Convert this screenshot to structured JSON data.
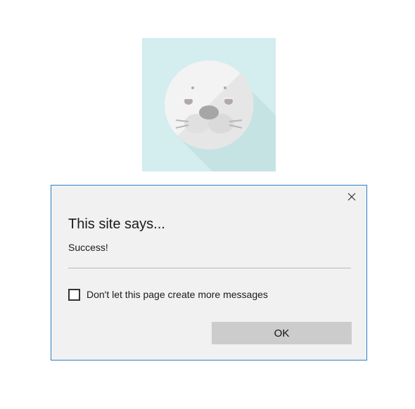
{
  "dialog": {
    "title": "This site says...",
    "message": "Success!",
    "checkbox_label": "Don't let this page create more messages",
    "checkbox_checked": false,
    "ok_label": "OK"
  },
  "colors": {
    "tile_background": "#d4edef",
    "dialog_background": "#f1f1f1",
    "dialog_border": "#2b7fc7",
    "ok_button": "#cccccc"
  },
  "icons": {
    "site_image": "seal-face-icon",
    "close": "close-icon"
  }
}
